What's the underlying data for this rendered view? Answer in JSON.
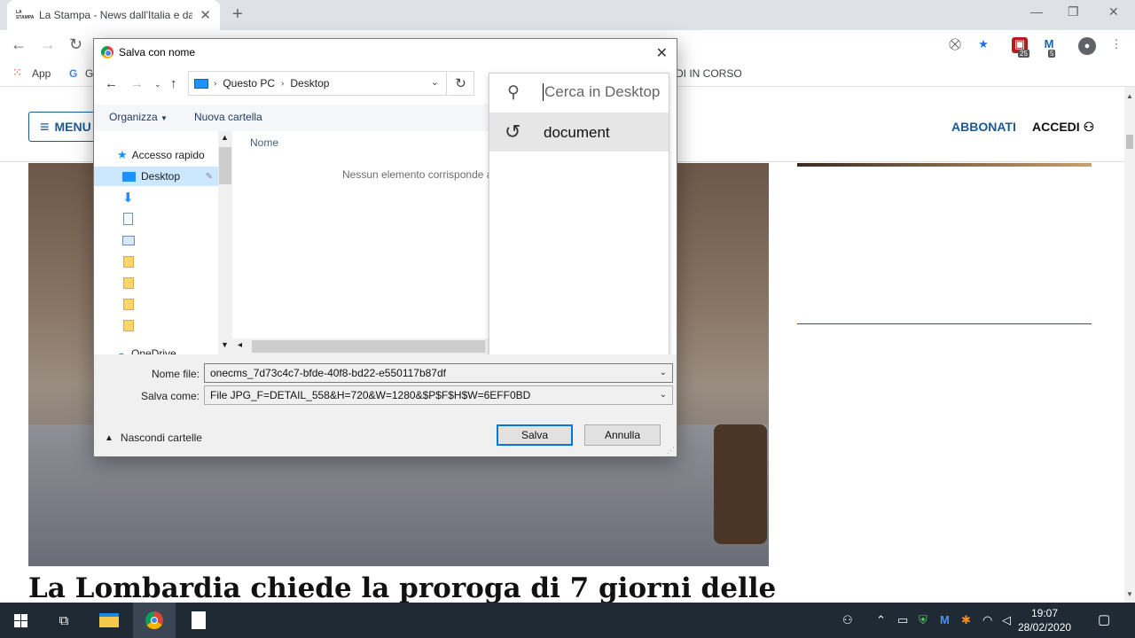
{
  "browser": {
    "tab_title": "La Stampa - News dall'Italia e dal mondo",
    "tab_favicon": "LA STAMPA",
    "bookmarks": [
      {
        "label": "App",
        "icon": "apps-grid-icon"
      },
      {
        "label": "G",
        "icon": "google-icon"
      }
    ],
    "bookmark_partial": "DI IN CORSO",
    "ext_badge_1": "25",
    "ext_badge_2": "5"
  },
  "page": {
    "menu_label": "MENU",
    "abbonati": "ABBONATI",
    "accedi": "ACCEDI",
    "headline": "La Lombardia chiede la proroga di 7 giorni delle"
  },
  "dialog": {
    "title": "Salva con nome",
    "breadcrumb": [
      "Questo PC",
      "Desktop"
    ],
    "cmd_organize": "Organizza",
    "cmd_new_folder": "Nuova cartella",
    "nav": {
      "quick_access": "Accesso rapido",
      "desktop": "Desktop",
      "onedrive": "OneDrive"
    },
    "column_name": "Nome",
    "empty_message": "Nessun elemento corrisponde ai criteri di ricerca.",
    "search_placeholder": "Cerca in Desktop",
    "search_suggestion": "document",
    "filename_label": "Nome file:",
    "filename_value": "onecms_7d73c4c7-bfde-40f8-bd22-e550117b87df",
    "savetype_label": "Salva come:",
    "savetype_value": "File JPG_F=DETAIL_558&H=720&W=1280&$P$F$H$W=6EFF0BD",
    "hide_folders": "Nascondi cartelle",
    "save_button": "Salva",
    "cancel_button": "Annulla"
  },
  "taskbar": {
    "time": "19:07",
    "date": "28/02/2020"
  },
  "colors": {
    "brand_blue": "#1c5a96",
    "accent": "#0078d7",
    "taskbar": "#1f2a35"
  }
}
